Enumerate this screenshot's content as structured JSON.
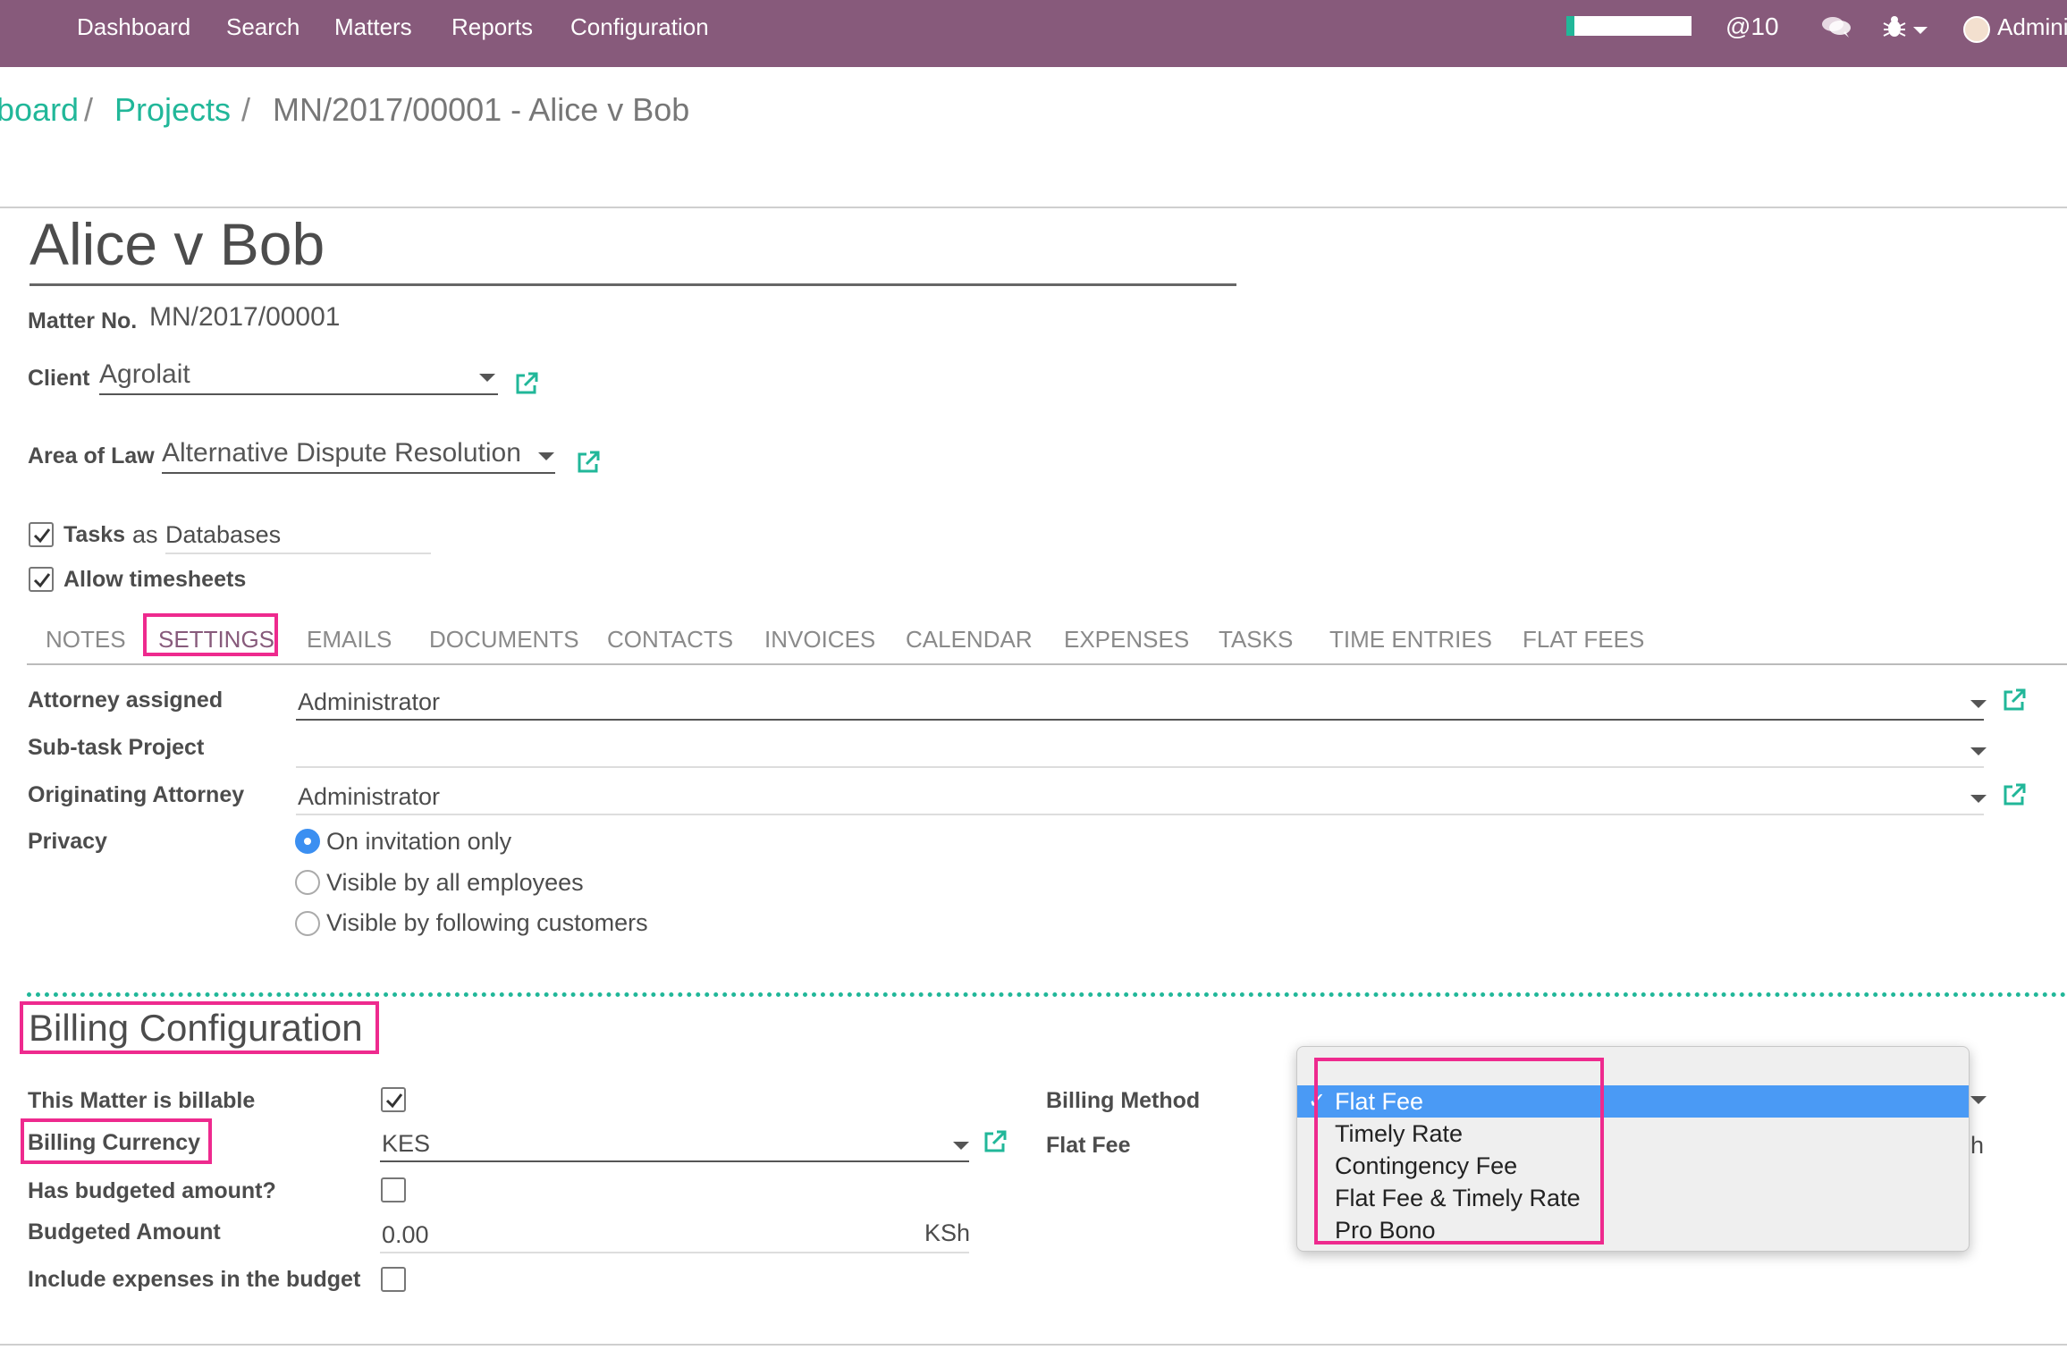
{
  "topnav": {
    "items": [
      "Dashboard",
      "Search",
      "Matters",
      "Reports",
      "Configuration"
    ],
    "mentions": "@10",
    "user": "Admini"
  },
  "breadcrumb": {
    "root": "board",
    "projects": "Projects",
    "current": "MN/2017/00001 - Alice v Bob",
    "separator": "/"
  },
  "record": {
    "title": "Alice v Bob",
    "matter_no_label": "Matter No.",
    "matter_no": "MN/2017/00001",
    "client_label": "Client",
    "client": "Agrolait",
    "area_label": "Area of Law",
    "area": "Alternative Dispute Resolution",
    "tasks_label": "Tasks",
    "tasks_as": "as",
    "tasks_alias": "Databases",
    "timesheets_label": "Allow timesheets"
  },
  "tabs": [
    "NOTES",
    "SETTINGS",
    "EMAILS",
    "DOCUMENTS",
    "CONTACTS",
    "INVOICES",
    "CALENDAR",
    "EXPENSES",
    "TASKS",
    "TIME ENTRIES",
    "FLAT FEES"
  ],
  "settings": {
    "attorney_label": "Attorney assigned",
    "attorney": "Administrator",
    "subtask_label": "Sub-task Project",
    "subtask": "",
    "originating_label": "Originating Attorney",
    "originating": "Administrator",
    "privacy_label": "Privacy",
    "privacy_options": [
      "On invitation only",
      "Visible by all employees",
      "Visible by following customers"
    ]
  },
  "billing": {
    "section_title": "Billing Configuration",
    "billable_label": "This Matter is billable",
    "currency_label": "Billing Currency",
    "currency": "KES",
    "has_budget_label": "Has budgeted amount?",
    "budget_amount_label": "Budgeted Amount",
    "budget_amount": "0.00",
    "budget_currency": "KSh",
    "include_expenses_label": "Include expenses in the budget",
    "method_label": "Billing Method",
    "flat_fee_label": "Flat Fee",
    "flat_fee_peek": "h",
    "method_options": [
      "Flat Fee",
      "Timely Rate",
      "Contingency Fee",
      "Flat Fee & Timely Rate",
      "Pro Bono"
    ],
    "selected_check": "✓"
  },
  "colors": {
    "navbar": "#875a7b",
    "link": "#21b799",
    "highlight": "#ee2a8e",
    "selection": "#4a9af5"
  }
}
